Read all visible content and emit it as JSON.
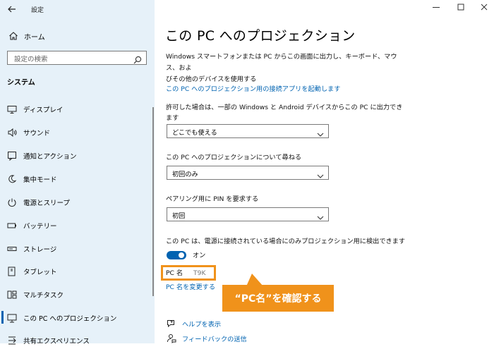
{
  "window": {
    "title": "設定"
  },
  "sidebar": {
    "home_label": "ホーム",
    "search_placeholder": "設定の検索",
    "section_title": "システム",
    "items": [
      {
        "label": "ディスプレイ",
        "icon": "display-icon"
      },
      {
        "label": "サウンド",
        "icon": "speaker-icon"
      },
      {
        "label": "通知とアクション",
        "icon": "notification-icon"
      },
      {
        "label": "集中モード",
        "icon": "moon-icon"
      },
      {
        "label": "電源とスリープ",
        "icon": "power-icon"
      },
      {
        "label": "バッテリー",
        "icon": "battery-icon"
      },
      {
        "label": "ストレージ",
        "icon": "storage-icon"
      },
      {
        "label": "タブレット",
        "icon": "tablet-icon"
      },
      {
        "label": "マルチタスク",
        "icon": "multitask-icon"
      },
      {
        "label": "この PC へのプロジェクション",
        "icon": "projection-icon",
        "selected": true
      },
      {
        "label": "共有エクスペリエンス",
        "icon": "shared-experience-icon"
      }
    ]
  },
  "main": {
    "page_title": "この PC へのプロジェクション",
    "description_line1": "Windows スマートフォンまたは PC からこの画面に出力し、キーボード、マウス、およ",
    "description_line2": "びその他のデバイスを使用する",
    "launch_link": "この PC へのプロジェクション用の接続アプリを起動します",
    "setting1_label_line1": "許可した場合は、一部の Windows と Android デバイスからこの PC に出力でき",
    "setting1_label_line2": "ます",
    "setting1_value": "どこでも使える",
    "setting2_label": "この PC へのプロジェクションについて尋ねる",
    "setting2_value": "初回のみ",
    "setting3_label": "ペアリング用に PIN を要求する",
    "setting3_value": "初回",
    "setting4_label": "この PC は、電源に接続されている場合にのみプロジェクション用に検出できます",
    "toggle_state": "オン",
    "pc_name_label": "PC 名",
    "pc_name_value": "T9K",
    "rename_link": "PC 名を変更する",
    "help_link": "ヘルプを表示",
    "feedback_link": "フィードバックの送信"
  },
  "callout": {
    "text": "“PC名”を確認する"
  },
  "colors": {
    "accent": "#0063b1",
    "highlight": "#f0921b",
    "sidebar_bg": "#e6f1f9"
  }
}
